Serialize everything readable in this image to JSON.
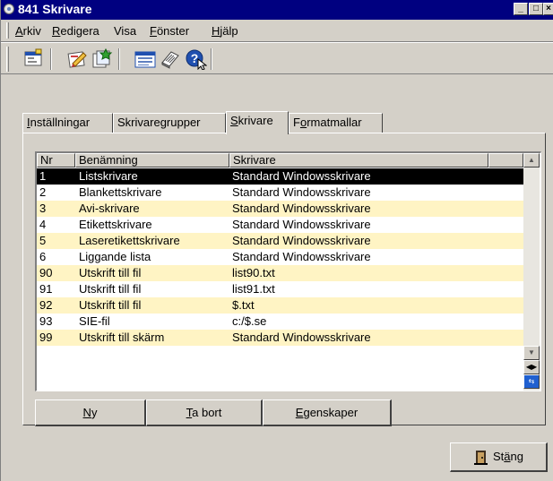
{
  "window": {
    "title": "841 Skrivare"
  },
  "menu": {
    "items": [
      {
        "label": "Arkiv"
      },
      {
        "label": "Redigera"
      },
      {
        "label": "Visa"
      },
      {
        "label": "Fönster"
      },
      {
        "label": "Hjälp"
      }
    ]
  },
  "toolbar": {
    "icons": [
      "properties-icon",
      "edit-icon",
      "new-icon",
      "list-view-icon",
      "notepad-icon",
      "help-icon"
    ]
  },
  "tabs": [
    {
      "label": "Inställningar"
    },
    {
      "label": "Skrivaregrupper"
    },
    {
      "label": "Skrivare"
    },
    {
      "label": "Formatmallar"
    }
  ],
  "table": {
    "columns": [
      "Nr",
      "Benämning",
      "Skrivare"
    ],
    "rows": [
      {
        "nr": "1",
        "name": "Listskrivare",
        "printer": "Standard Windowsskrivare"
      },
      {
        "nr": "2",
        "name": "Blankettskrivare",
        "printer": "Standard Windowsskrivare"
      },
      {
        "nr": "3",
        "name": "Avi-skrivare",
        "printer": "Standard Windowsskrivare"
      },
      {
        "nr": "4",
        "name": "Etikettskrivare",
        "printer": "Standard Windowsskrivare"
      },
      {
        "nr": "5",
        "name": "Laseretikettskrivare",
        "printer": "Standard Windowsskrivare"
      },
      {
        "nr": "6",
        "name": "Liggande lista",
        "printer": "Standard Windowsskrivare"
      },
      {
        "nr": "90",
        "name": "Utskrift till fil",
        "printer": "list90.txt"
      },
      {
        "nr": "91",
        "name": "Utskrift till fil",
        "printer": "list91.txt"
      },
      {
        "nr": "92",
        "name": "Utskrift till fil",
        "printer": "$.txt"
      },
      {
        "nr": "93",
        "name": "SIE-fil",
        "printer": "c:/$.se"
      },
      {
        "nr": "99",
        "name": "Utskrift till skärm",
        "printer": "Standard Windowsskrivare"
      }
    ]
  },
  "buttons": {
    "new": "Ny",
    "delete": "Ta bort",
    "properties": "Egenskaper",
    "close": "Stäng"
  },
  "colors": {
    "title_bar": "#000080",
    "row_highlight": "#fff4c4",
    "selected_row": "#000000"
  }
}
